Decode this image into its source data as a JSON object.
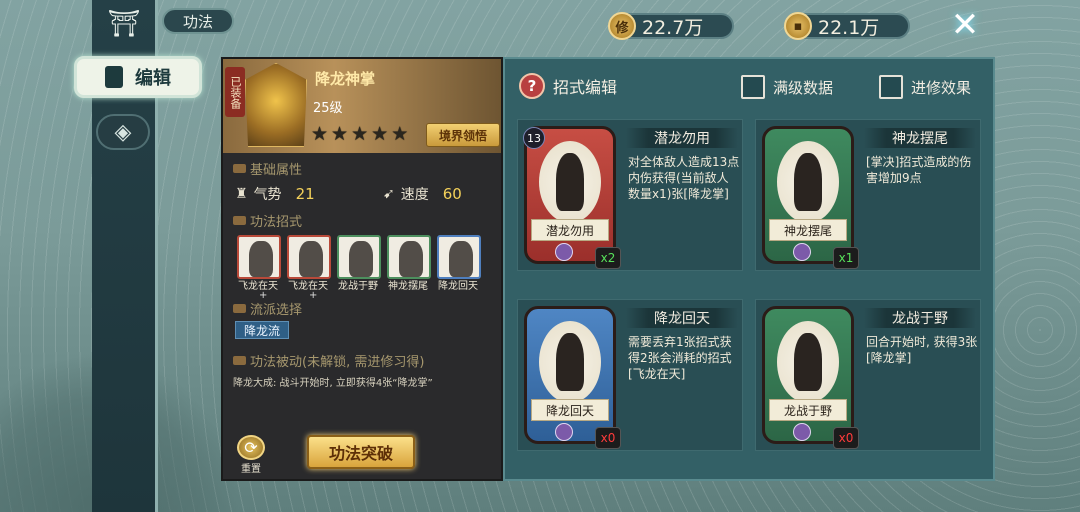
{
  "header": {
    "title": "功法",
    "resource1": "22.7万",
    "resource2": "22.1万",
    "coin1_icon": "修",
    "coin2_icon": "▪"
  },
  "sidebar": {
    "edit_label": "编辑"
  },
  "skill": {
    "equipped_tag": "已装备",
    "name": "降龙神掌",
    "level": "25级",
    "stars": 5,
    "realm_button": "境界领悟",
    "base_attr_title": "基础属性",
    "attr1_label": "气势",
    "attr1_value": "21",
    "attr2_label": "速度",
    "attr2_value": "60",
    "moves_title": "功法招式",
    "moves": [
      "飞龙在天",
      "飞龙在天",
      "龙战于野",
      "神龙摆尾",
      "降龙回天"
    ],
    "school_title": "流派选择",
    "school_tag": "降龙流",
    "passive_title": "功法被动(未解锁, 需进修习得)",
    "passive_desc": "降龙大成: 战斗开始时, 立即获得4张“降龙掌”",
    "reset_label": "重置",
    "break_button": "功法突破"
  },
  "editor": {
    "title": "招式编辑",
    "check1": "满级数据",
    "check2": "进修效果",
    "cards": [
      {
        "name": "潜龙勿用",
        "desc": "对全体敌人造成13点内伤获得(当前敌人数量x1)张[降龙掌]",
        "cost": "13",
        "count": "x2",
        "color": "red"
      },
      {
        "name": "神龙摆尾",
        "desc": "[掌决]招式造成的伤害增加9点",
        "cost": "",
        "count": "x1",
        "color": "green"
      },
      {
        "name": "降龙回天",
        "desc": "需要丢弃1张招式获得2张会消耗的招式[飞龙在天]",
        "cost": "",
        "count": "x0",
        "color": "blue"
      },
      {
        "name": "龙战于野",
        "desc": "回合开始时, 获得3张[降龙掌]",
        "cost": "",
        "count": "x0",
        "color": "green"
      }
    ]
  }
}
